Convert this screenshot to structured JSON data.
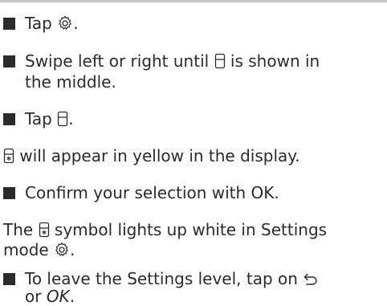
{
  "steps": {
    "tap_settings": {
      "prefix": "Tap",
      "suffix": ".",
      "icon": "gear-icon"
    },
    "swipe": {
      "line1_before": "Swipe left or right until",
      "line1_after": "is shown in",
      "line2": "the middle.",
      "icon": "fridge-icon"
    },
    "tap_fridge": {
      "prefix": "Tap",
      "suffix": ".",
      "icon": "fridge-icon"
    },
    "note_yellow": {
      "text": "will appear in yellow in the display.",
      "icon": "fridge-snowflake-icon"
    },
    "confirm": {
      "text": "Confirm your selection with OK."
    },
    "note_white": {
      "before": "The",
      "after": "symbol lights up white in Settings",
      "line2": "mode",
      "line2_suffix": ".",
      "icon": "fridge-snowflake-icon",
      "icon2": "gear-icon"
    },
    "leave": {
      "line1": "To leave the Settings level, tap on",
      "line2_prefix": "or",
      "line2_ok": "OK",
      "line2_suffix": ".",
      "icon": "back-arrow-icon"
    }
  },
  "colors": {
    "text": "#2b2b2b",
    "rule": "#c9c9c9"
  }
}
